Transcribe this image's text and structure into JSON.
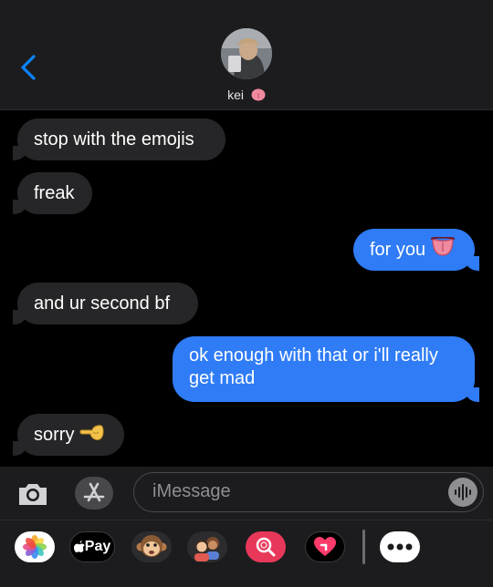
{
  "header": {
    "back_label": "Back",
    "contact_name": "kei"
  },
  "thread": {
    "messages": [
      {
        "direction": "incoming",
        "text": "stop with the emojis"
      },
      {
        "direction": "incoming",
        "text": "freak"
      },
      {
        "direction": "outgoing",
        "text": "for you",
        "emoji": "tongue-emoji"
      },
      {
        "direction": "incoming",
        "text": "and ur second bf"
      },
      {
        "direction": "outgoing",
        "text_line1": "ok enough with that or i'll really",
        "text_line2": "get mad"
      },
      {
        "direction": "incoming",
        "text": "sorry",
        "emoji": "pointing-hand-emoji"
      }
    ]
  },
  "compose": {
    "placeholder": "iMessage"
  },
  "drawer": {
    "apple_pay_label": "Pay",
    "apps": [
      "photos-icon",
      "apple-pay-icon",
      "monkey-memoji-icon",
      "memoji-icon",
      "image-search-icon",
      "digital-touch-icon",
      "more-icon"
    ]
  },
  "colors": {
    "outgoing_bubble": "#2f7cf6",
    "incoming_bubble": "#262628",
    "accent_blue": "#0a84ff"
  }
}
